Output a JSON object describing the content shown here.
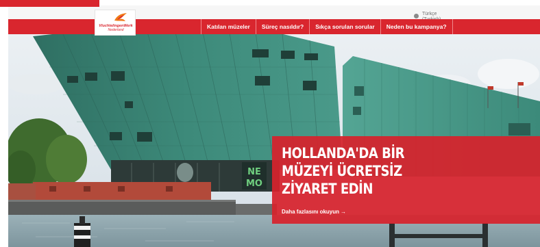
{
  "language": {
    "name": "Türkçe",
    "native": "(Turkish)",
    "icon": "globe-icon"
  },
  "logo": {
    "name": "VluchtelingenWerk",
    "sub": "Nederland",
    "icon": "bird-icon"
  },
  "nav": {
    "items": [
      {
        "label": "Katılan müzeler"
      },
      {
        "label": "Süreç nasıldır?"
      },
      {
        "label": "Sıkça sorulan sorular"
      },
      {
        "label": "Neden bu kampanya?"
      }
    ]
  },
  "hero": {
    "title_line1": "HOLLANDA'DA BİR",
    "title_line2": "MÜZEYİ ÜCRETSİZ",
    "title_line3": "ZİYARET EDİN",
    "link_label": "Daha fazlasını okuyun",
    "link_arrow": "→",
    "building_sign_1": "NE",
    "building_sign_2": "MO"
  },
  "colors": {
    "brand_red": "#d9262e",
    "building_green": "#3f8f80",
    "sky": "#dde6ec",
    "water": "#8aa2ab"
  }
}
